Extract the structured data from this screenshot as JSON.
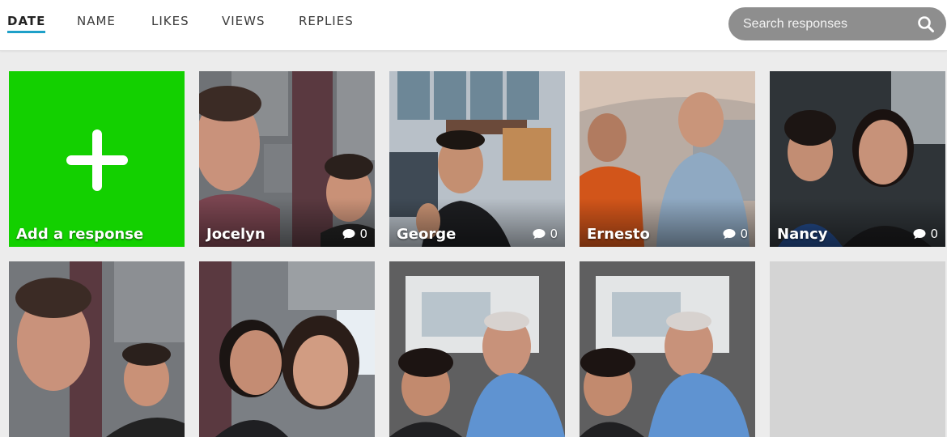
{
  "sort_tabs": [
    {
      "label": "DATE",
      "active": true
    },
    {
      "label": "NAME",
      "active": false
    },
    {
      "label": "LIKES",
      "active": false
    },
    {
      "label": "VIEWS",
      "active": false
    },
    {
      "label": "REPLIES",
      "active": false
    }
  ],
  "search": {
    "placeholder": "Search responses",
    "icon": "search-icon"
  },
  "add_tile": {
    "label": "Add a response",
    "color": "#13d000",
    "icon": "plus-icon"
  },
  "responses": [
    {
      "name": "Jocelyn",
      "replies": "0"
    },
    {
      "name": "George",
      "replies": "0"
    },
    {
      "name": "Ernesto",
      "replies": "0"
    },
    {
      "name": "Nancy",
      "replies": "0"
    }
  ],
  "colors": {
    "accent": "#1ea0c8",
    "search_bg": "#8e8e8e",
    "background": "#ececec"
  }
}
